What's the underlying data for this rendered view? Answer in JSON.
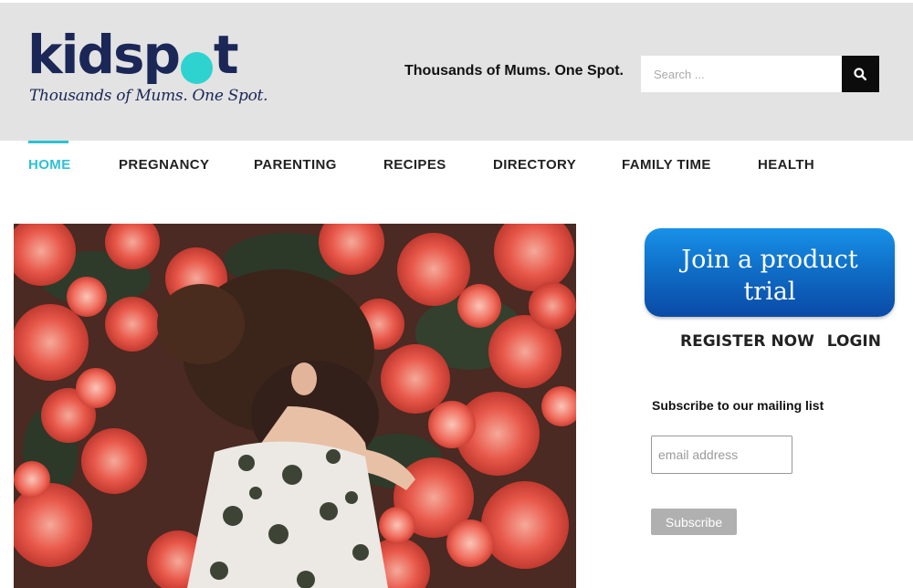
{
  "header": {
    "logo": {
      "word": "kidspot",
      "tagline": "Thousands of Mums. One Spot."
    },
    "tagline": "Thousands of Mums. One Spot.",
    "search": {
      "placeholder": "Search ...",
      "value": ""
    },
    "search_icon": "search-icon"
  },
  "nav": {
    "items": [
      {
        "label": "HOME",
        "active": true
      },
      {
        "label": "PREGNANCY"
      },
      {
        "label": "PARENTING"
      },
      {
        "label": "RECIPES"
      },
      {
        "label": "DIRECTORY"
      },
      {
        "label": "FAMILY TIME"
      },
      {
        "label": "HEALTH"
      }
    ],
    "accent_color": "#2ec1d3"
  },
  "sidebar": {
    "promo": {
      "label": "Join a product trial"
    },
    "register_label": "REGISTER NOW",
    "login_label": "LOGIN",
    "mailing": {
      "title": "Subscribe to our mailing list",
      "email_placeholder": "email address",
      "email_value": "",
      "subscribe_label": "Subscribe"
    }
  },
  "colors": {
    "brand_navy": "#1b2757",
    "brand_teal": "#2ed3d0",
    "header_bg": "#e3e3e3",
    "promo_blue": "#1280dc"
  }
}
